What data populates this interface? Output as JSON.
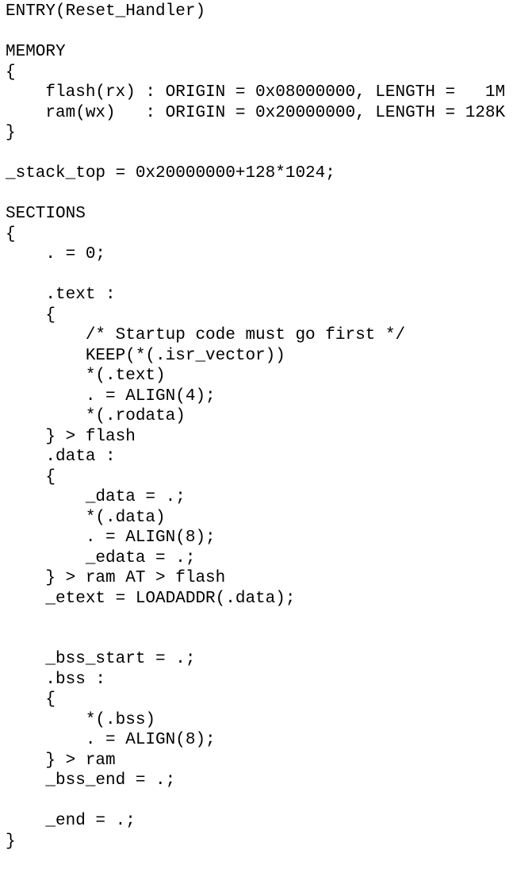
{
  "document": {
    "lines": [
      "ENTRY(Reset_Handler)",
      "",
      "MEMORY",
      "{",
      "    flash(rx) : ORIGIN = 0x08000000, LENGTH =   1M",
      "    ram(wx)   : ORIGIN = 0x20000000, LENGTH = 128K",
      "}",
      "",
      "_stack_top = 0x20000000+128*1024;",
      "",
      "SECTIONS",
      "{",
      "    . = 0;",
      "",
      "    .text :",
      "    {",
      "        /* Startup code must go first */",
      "        KEEP(*(.isr_vector))",
      "        *(.text)",
      "        . = ALIGN(4);",
      "        *(.rodata)",
      "    } > flash",
      "    .data :",
      "    {",
      "        _data = .;",
      "        *(.data)",
      "        . = ALIGN(8);",
      "        _edata = .;",
      "    } > ram AT > flash",
      "    _etext = LOADADDR(.data);",
      "",
      "",
      "    _bss_start = .;",
      "    .bss :",
      "    {",
      "        *(.bss)",
      "        . = ALIGN(8);",
      "    } > ram",
      "    _bss_end = .;",
      "",
      "    _end = .;",
      "}"
    ]
  }
}
